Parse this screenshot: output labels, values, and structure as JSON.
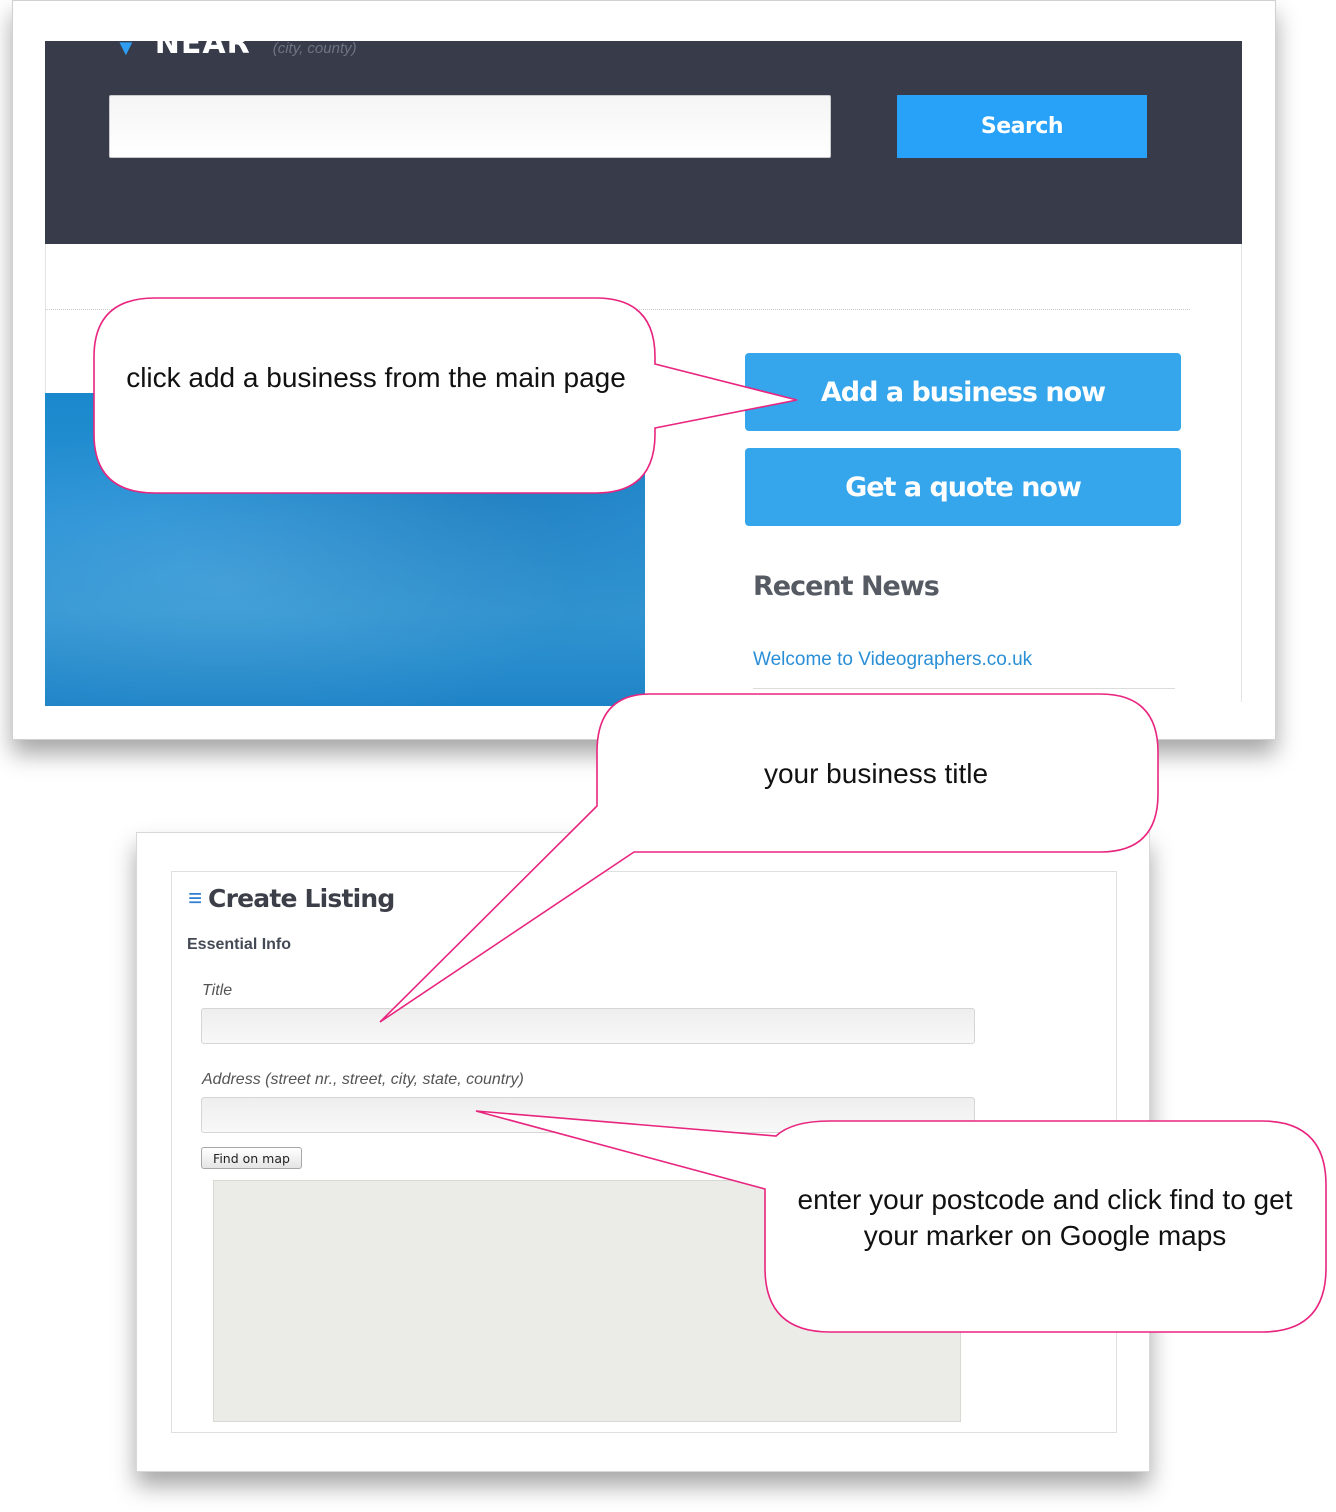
{
  "top_screen": {
    "near_label": "NEAR",
    "near_hint": "(city, county)",
    "search": {
      "value": "",
      "button_label": "Search"
    },
    "add_business_label": "Add a business now",
    "get_quote_label": "Get a quote now",
    "recent_news": {
      "heading": "Recent News",
      "items": [
        "Welcome to Videographers.co.uk"
      ]
    }
  },
  "bottom_screen": {
    "header_title": "Create Listing",
    "section_label": "Essential Info",
    "title_field": {
      "label": "Title",
      "value": ""
    },
    "address_field": {
      "label": "Address (street nr., street, city, state, country)",
      "value": ""
    },
    "find_on_map_label": "Find on map"
  },
  "callouts": {
    "add_business": "click add a business from the main page",
    "business_title": "your business title",
    "postcode": "enter your postcode and click find to get your marker on Google maps"
  },
  "colors": {
    "header_bg": "#373b4a",
    "search_button": "#27a2f8",
    "cta_button": "#36a6ec",
    "callout_border": "#e8257f",
    "link": "#2a8fd6",
    "map_bg": "#ebebe8"
  },
  "icons": {
    "location": "location-pin-icon",
    "menu": "menu-lines-icon"
  }
}
